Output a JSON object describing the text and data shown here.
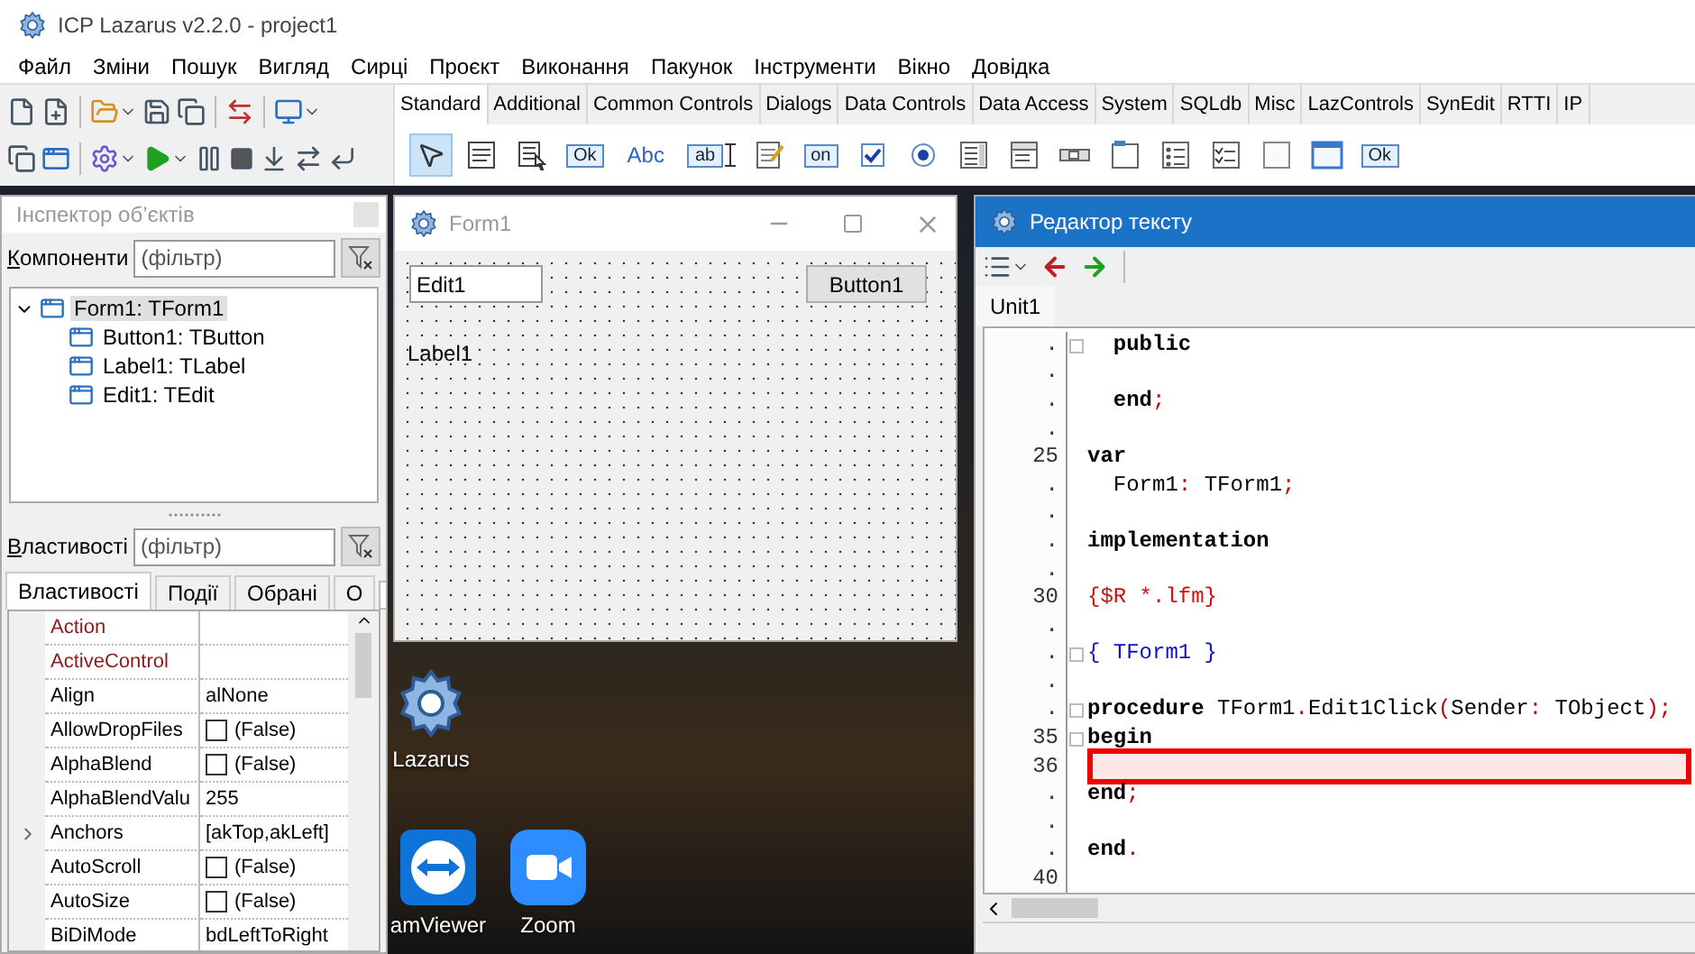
{
  "ide": {
    "title": "ICP Lazarus v2.2.0 - project1",
    "menu": [
      "Файл",
      "Зміни",
      "Пошук",
      "Вигляд",
      "Сирці",
      "Проєкт",
      "Виконання",
      "Пакунок",
      "Інструменти",
      "Вікно",
      "Довідка"
    ],
    "palette_tabs": [
      {
        "label": "Standard",
        "selected": true
      },
      {
        "label": "Additional",
        "selected": false
      },
      {
        "label": "Common Controls",
        "selected": false
      },
      {
        "label": "Dialogs",
        "selected": false
      },
      {
        "label": "Data Controls",
        "selected": false
      },
      {
        "label": "Data Access",
        "selected": false
      },
      {
        "label": "System",
        "selected": false
      },
      {
        "label": "SQLdb",
        "selected": false
      },
      {
        "label": "Misc",
        "selected": false
      },
      {
        "label": "LazControls",
        "selected": false
      },
      {
        "label": "SynEdit",
        "selected": false
      },
      {
        "label": "RTTI",
        "selected": false
      },
      {
        "label": "IP",
        "selected": false
      }
    ],
    "palette_items": [
      {
        "kind": "pointer",
        "selected": true
      },
      {
        "kind": "mainmenu",
        "selected": false
      },
      {
        "kind": "popupmenu",
        "selected": false
      },
      {
        "kind": "button",
        "label": "Ok",
        "selected": false
      },
      {
        "kind": "label",
        "label": "Abc",
        "selected": false
      },
      {
        "kind": "edit",
        "label": "ab",
        "selected": false
      },
      {
        "kind": "memo",
        "selected": false
      },
      {
        "kind": "toggle",
        "label": "on",
        "selected": false
      },
      {
        "kind": "checkbox",
        "selected": false
      },
      {
        "kind": "radio",
        "selected": false
      },
      {
        "kind": "listbox",
        "selected": false
      },
      {
        "kind": "combobox",
        "selected": false
      },
      {
        "kind": "scrollbar",
        "selected": false
      },
      {
        "kind": "groupbox",
        "selected": false
      },
      {
        "kind": "radiogroup",
        "selected": false
      },
      {
        "kind": "checkgroup",
        "selected": false
      },
      {
        "kind": "panel",
        "selected": false
      },
      {
        "kind": "frame",
        "selected": false
      },
      {
        "kind": "actionlist",
        "label": "Ok",
        "selected": false
      }
    ]
  },
  "inspector": {
    "title": "Інспектор об’єктів",
    "components_label": "Компоненти",
    "components_filter": {
      "placeholder": "(фільтр)"
    },
    "tree": [
      {
        "label": "Form1: TForm1",
        "selected": true,
        "expanded": true,
        "children": [
          {
            "label": "Button1: TButton",
            "selected": false
          },
          {
            "label": "Label1: TLabel",
            "selected": false
          },
          {
            "label": "Edit1: TEdit",
            "selected": false
          }
        ]
      }
    ],
    "properties_label": "Властивості",
    "properties_filter": {
      "placeholder": "(фільтр)"
    },
    "tabs": [
      {
        "label": "Властивості",
        "selected": true
      },
      {
        "label": "Події",
        "selected": false
      },
      {
        "label": "Обрані",
        "selected": false
      },
      {
        "label": "О",
        "selected": false
      }
    ],
    "properties": [
      {
        "name": "Action",
        "kind": "text",
        "reference": true,
        "expandable": false
      },
      {
        "name": "ActiveControl",
        "kind": "text",
        "reference": true,
        "expandable": false
      },
      {
        "name": "Align",
        "value": "alNone",
        "kind": "text",
        "reference": false,
        "expandable": false
      },
      {
        "name": "AllowDropFiles",
        "value": "(False)",
        "kind": "checkbox",
        "checked": false,
        "reference": false,
        "expandable": false
      },
      {
        "name": "AlphaBlend",
        "value": "(False)",
        "kind": "checkbox",
        "checked": false,
        "reference": false,
        "expandable": false
      },
      {
        "name": "AlphaBlendValu",
        "value": "255",
        "kind": "text",
        "reference": false,
        "expandable": false
      },
      {
        "name": "Anchors",
        "value": "[akTop,akLeft]",
        "kind": "text",
        "reference": false,
        "expandable": true
      },
      {
        "name": "AutoScroll",
        "value": "(False)",
        "kind": "checkbox",
        "checked": false,
        "reference": false,
        "expandable": false
      },
      {
        "name": "AutoSize",
        "value": "(False)",
        "kind": "checkbox",
        "checked": false,
        "reference": false,
        "expandable": false
      },
      {
        "name": "BiDiMode",
        "value": "bdLeftToRight",
        "kind": "text",
        "reference": false,
        "expandable": false
      }
    ]
  },
  "form_designer": {
    "title": "Form1",
    "edit": {
      "value": "Edit1"
    },
    "button": "Button1",
    "label": "Label1"
  },
  "desktop_icons": [
    {
      "label": "Lazarus",
      "kind": "gear"
    },
    {
      "label": "amViewer",
      "kind": "arrows"
    },
    {
      "label": "Zoom",
      "kind": "camera"
    }
  ],
  "editor": {
    "title": "Редактор тексту",
    "tabs": [
      {
        "label": "Unit1",
        "selected": true
      }
    ],
    "lines": [
      {
        "gutter": ".",
        "fold": true,
        "current": false,
        "segments": [
          {
            "text": "  public",
            "kind": "keyword"
          }
        ]
      },
      {
        "gutter": ".",
        "fold": false,
        "current": false
      },
      {
        "gutter": ".",
        "fold": false,
        "current": false,
        "segments": [
          {
            "text": "  end",
            "kind": "keyword"
          },
          {
            "text": ";",
            "kind": "symbol"
          }
        ]
      },
      {
        "gutter": ".",
        "fold": false,
        "current": false
      },
      {
        "gutter": "25",
        "fold": false,
        "current": false,
        "segments": [
          {
            "text": "var",
            "kind": "keyword"
          }
        ]
      },
      {
        "gutter": ".",
        "fold": false,
        "current": false,
        "segments": [
          {
            "text": "  Form1"
          },
          {
            "text": ":",
            "kind": "symbol"
          },
          {
            "text": " TForm1"
          },
          {
            "text": ";",
            "kind": "symbol"
          }
        ]
      },
      {
        "gutter": ".",
        "fold": false,
        "current": false
      },
      {
        "gutter": ".",
        "fold": false,
        "current": false,
        "segments": [
          {
            "text": "implementation",
            "kind": "keyword"
          }
        ]
      },
      {
        "gutter": ".",
        "fold": false,
        "current": false
      },
      {
        "gutter": "30",
        "fold": false,
        "current": false,
        "segments": [
          {
            "text": "{$R *.lfm}",
            "kind": "directive"
          }
        ]
      },
      {
        "gutter": ".",
        "fold": false,
        "current": false
      },
      {
        "gutter": ".",
        "fold": true,
        "current": false,
        "segments": [
          {
            "text": "{ TForm1 }",
            "kind": "comment"
          }
        ]
      },
      {
        "gutter": ".",
        "fold": false,
        "current": false
      },
      {
        "gutter": ".",
        "fold": true,
        "current": false,
        "segments": [
          {
            "text": "procedure",
            "kind": "keyword"
          },
          {
            "text": " TForm1"
          },
          {
            "text": ".",
            "kind": "symbol"
          },
          {
            "text": "Edit1Click"
          },
          {
            "text": "(",
            "kind": "symbol"
          },
          {
            "text": "Sender"
          },
          {
            "text": ":",
            "kind": "symbol"
          },
          {
            "text": " TObject"
          },
          {
            "text": ");",
            "kind": "symbol"
          }
        ]
      },
      {
        "gutter": "35",
        "fold": true,
        "current": false,
        "segments": [
          {
            "text": "begin",
            "kind": "keyword"
          }
        ]
      },
      {
        "gutter": "36",
        "fold": false,
        "current": true
      },
      {
        "gutter": ".",
        "fold": false,
        "current": false,
        "segments": [
          {
            "text": "end",
            "kind": "keyword"
          },
          {
            "text": ";",
            "kind": "symbol"
          }
        ]
      },
      {
        "gutter": ".",
        "fold": false,
        "current": false
      },
      {
        "gutter": ".",
        "fold": false,
        "current": false,
        "segments": [
          {
            "text": "end",
            "kind": "keyword"
          },
          {
            "text": ".",
            "kind": "symbol"
          }
        ]
      },
      {
        "gutter": "40",
        "fold": false,
        "current": false
      }
    ]
  }
}
